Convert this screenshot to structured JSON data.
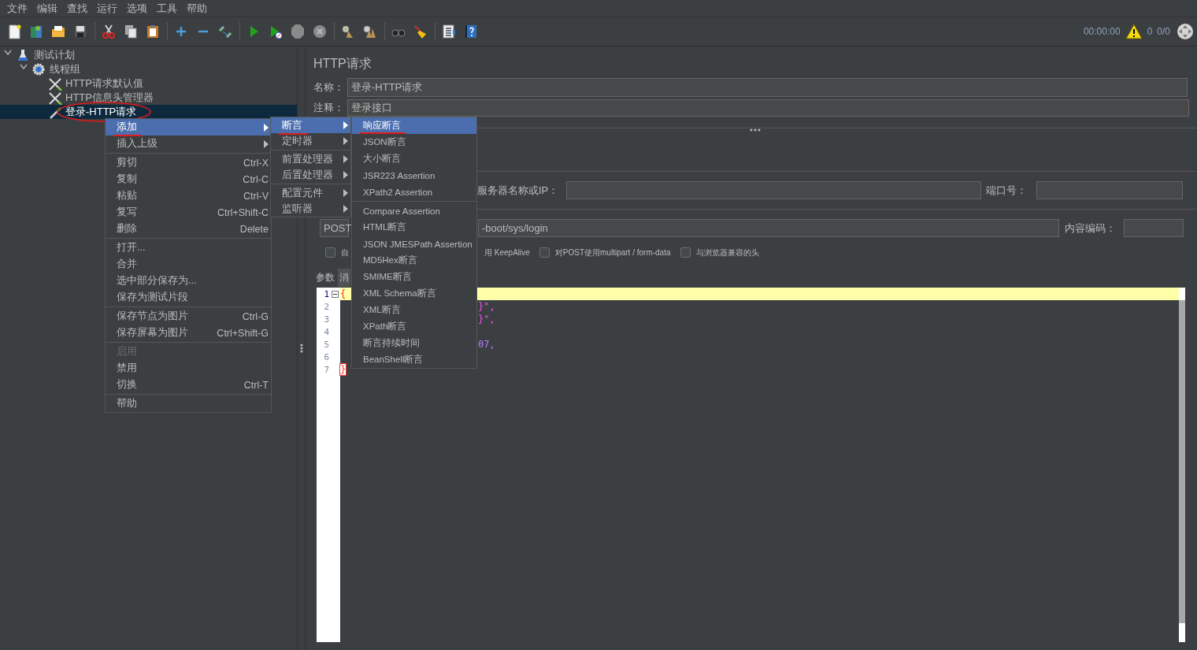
{
  "menubar": [
    "文件",
    "编辑",
    "查找",
    "运行",
    "选项",
    "工具",
    "帮助"
  ],
  "toolbar": {
    "timer": "00:00:00",
    "warnings": "0",
    "threads": "0/0"
  },
  "tree": [
    {
      "label": "测试计划",
      "kind": "plan",
      "selected": false,
      "circled": false,
      "expanded": true,
      "children": [
        {
          "label": "线程组",
          "kind": "thread_group",
          "selected": false,
          "circled": false,
          "expanded": true,
          "children": [
            {
              "label": "HTTP请求默认值",
              "kind": "config",
              "selected": false,
              "circled": false
            },
            {
              "label": "HTTP信息头管理器",
              "kind": "config",
              "selected": false,
              "circled": false
            },
            {
              "label": "登录-HTTP请求",
              "kind": "sampler",
              "selected": true,
              "circled": true
            }
          ]
        }
      ]
    }
  ],
  "panel": {
    "title": "HTTP请求",
    "name_label": "名称：",
    "name_value": "登录-HTTP请求",
    "comment_label": "注释：",
    "comment_value": "登录接口",
    "server_label": "服务器名称或IP：",
    "port_label": "端口号：",
    "method": "POST",
    "path_value": "-boot/sys/login",
    "encoding_label": "内容编码：",
    "options": [
      {
        "label": "自",
        "checked": false
      },
      {
        "label": "用 KeepAlive"
      },
      {
        "label": "对POST使用multipart / form-data",
        "checked": false
      },
      {
        "label": "与浏览器兼容的头",
        "checked": false
      }
    ],
    "tabs": [
      {
        "label": "参数",
        "selected": false
      },
      {
        "label": "消",
        "selected": true
      }
    ]
  },
  "editor": {
    "lines": [
      {
        "number": "1",
        "text": "{",
        "kind": "brace",
        "current": true
      },
      {
        "number": "2",
        "text": "}\",",
        "kind": "string",
        "current": false
      },
      {
        "number": "3",
        "text": "}\",",
        "kind": "string",
        "current": false
      },
      {
        "number": "4",
        "current": false
      },
      {
        "number": "5",
        "text": "07,",
        "kind": "number",
        "current": false
      },
      {
        "number": "6",
        "current": false
      },
      {
        "number": "7",
        "text": "}",
        "kind": "matched_brace",
        "current": false
      }
    ]
  },
  "context_menus": [
    {
      "items": [
        {
          "kind": "item",
          "label": "添加",
          "submenu": true,
          "selected": true,
          "disabled": false,
          "underlined": true
        },
        {
          "kind": "item",
          "label": "插入上级",
          "submenu": true,
          "selected": false,
          "disabled": false,
          "underlined": false
        },
        {
          "kind": "separator"
        },
        {
          "kind": "item",
          "label": "剪切",
          "shortcut": "Ctrl-X",
          "selected": false,
          "disabled": false,
          "underlined": false
        },
        {
          "kind": "item",
          "label": "复制",
          "shortcut": "Ctrl-C",
          "selected": false,
          "disabled": false,
          "underlined": false
        },
        {
          "kind": "item",
          "label": "粘贴",
          "shortcut": "Ctrl-V",
          "selected": false,
          "disabled": false,
          "underlined": false
        },
        {
          "kind": "item",
          "label": "复写",
          "shortcut": "Ctrl+Shift-C",
          "selected": false,
          "disabled": false,
          "underlined": false
        },
        {
          "kind": "item",
          "label": "删除",
          "shortcut": "Delete",
          "selected": false,
          "disabled": false,
          "underlined": false
        },
        {
          "kind": "separator"
        },
        {
          "kind": "item",
          "label": "打开...",
          "selected": false,
          "disabled": false,
          "underlined": false
        },
        {
          "kind": "item",
          "label": "合并",
          "selected": false,
          "disabled": false,
          "underlined": false
        },
        {
          "kind": "item",
          "label": "选中部分保存为...",
          "selected": false,
          "disabled": false,
          "underlined": false
        },
        {
          "kind": "item",
          "label": "保存为测试片段",
          "selected": false,
          "disabled": false,
          "underlined": false
        },
        {
          "kind": "separator"
        },
        {
          "kind": "item",
          "label": "保存节点为图片",
          "shortcut": "Ctrl-G",
          "selected": false,
          "disabled": false,
          "underlined": false
        },
        {
          "kind": "item",
          "label": "保存屏幕为图片",
          "shortcut": "Ctrl+Shift-G",
          "selected": false,
          "disabled": false,
          "underlined": false
        },
        {
          "kind": "separator"
        },
        {
          "kind": "item",
          "label": "启用",
          "selected": false,
          "disabled": true,
          "underlined": false
        },
        {
          "kind": "item",
          "label": "禁用",
          "selected": false,
          "disabled": false,
          "underlined": false
        },
        {
          "kind": "item",
          "label": "切换",
          "shortcut": "Ctrl-T",
          "selected": false,
          "disabled": false,
          "underlined": false
        },
        {
          "kind": "separator"
        },
        {
          "kind": "item",
          "label": "帮助",
          "selected": false,
          "disabled": false,
          "underlined": false
        }
      ]
    },
    {
      "items": [
        {
          "kind": "item",
          "label": "断言",
          "submenu": true,
          "selected": true,
          "underlined": true
        },
        {
          "kind": "item",
          "label": "定时器",
          "submenu": true,
          "selected": false,
          "underlined": false
        },
        {
          "kind": "separator"
        },
        {
          "kind": "item",
          "label": "前置处理器",
          "submenu": true,
          "selected": false,
          "underlined": false
        },
        {
          "kind": "item",
          "label": "后置处理器",
          "submenu": true,
          "selected": false,
          "underlined": false
        },
        {
          "kind": "separator"
        },
        {
          "kind": "item",
          "label": "配置元件",
          "submenu": true,
          "selected": false,
          "underlined": false
        },
        {
          "kind": "item",
          "label": "监听器",
          "submenu": true,
          "selected": false,
          "underlined": false
        }
      ]
    },
    {
      "items": [
        {
          "kind": "item",
          "label": "响应断言",
          "selected": true,
          "underlined": true
        },
        {
          "kind": "item",
          "label": "JSON断言",
          "selected": false,
          "underlined": false
        },
        {
          "kind": "item",
          "label": "大小断言",
          "selected": false,
          "underlined": false
        },
        {
          "kind": "item",
          "label": "JSR223 Assertion",
          "selected": false,
          "underlined": false
        },
        {
          "kind": "item",
          "label": "XPath2 Assertion",
          "selected": false,
          "underlined": false
        },
        {
          "kind": "separator"
        },
        {
          "kind": "item",
          "label": "Compare Assertion",
          "selected": false,
          "underlined": false
        },
        {
          "kind": "item",
          "label": "HTML断言",
          "selected": false,
          "underlined": false
        },
        {
          "kind": "item",
          "label": "JSON JMESPath Assertion",
          "selected": false,
          "underlined": false
        },
        {
          "kind": "item",
          "label": "MD5Hex断言",
          "selected": false,
          "underlined": false
        },
        {
          "kind": "item",
          "label": "SMIME断言",
          "selected": false,
          "underlined": false
        },
        {
          "kind": "item",
          "label": "XML Schema断言",
          "selected": false,
          "underlined": false
        },
        {
          "kind": "item",
          "label": "XML断言",
          "selected": false,
          "underlined": false
        },
        {
          "kind": "item",
          "label": "XPath断言",
          "selected": false,
          "underlined": false
        },
        {
          "kind": "item",
          "label": "断言持续时间",
          "selected": false,
          "underlined": false
        },
        {
          "kind": "item",
          "label": "BeanShell断言",
          "selected": false,
          "underlined": false
        }
      ]
    }
  ]
}
